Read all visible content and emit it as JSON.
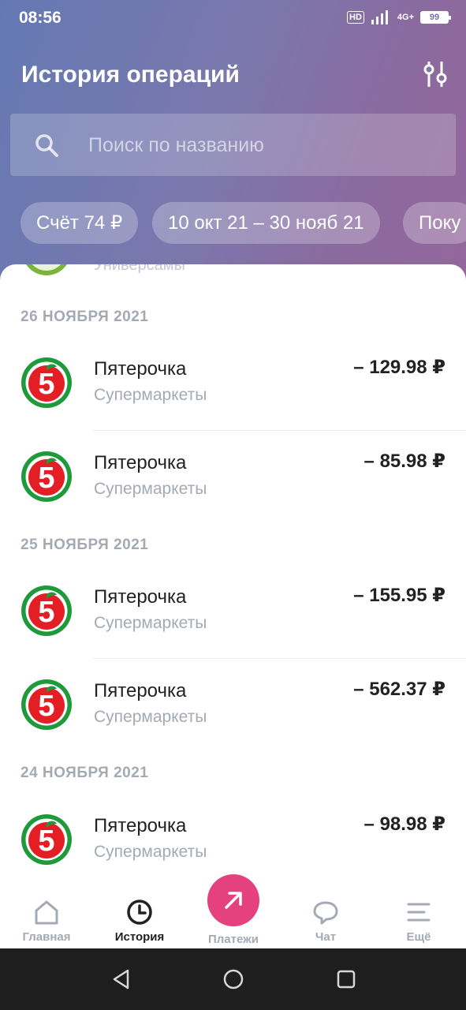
{
  "status": {
    "time": "08:56",
    "hd": "HD",
    "network": "4G+",
    "battery": "99"
  },
  "header": {
    "title": "История операций"
  },
  "search": {
    "placeholder": "Поиск по названию"
  },
  "chips": [
    "Счёт 74 ₽",
    "10 окт 21 – 30 нояб 21",
    "Поку"
  ],
  "partial_item": {
    "category": "Универсамы"
  },
  "groups": [
    {
      "date": "26 НОЯБРЯ 2021",
      "items": [
        {
          "name": "Пятерочка",
          "category": "Супермаркеты",
          "amount": "– 129.98 ₽"
        },
        {
          "name": "Пятерочка",
          "category": "Супермаркеты",
          "amount": "– 85.98 ₽"
        }
      ]
    },
    {
      "date": "25 НОЯБРЯ 2021",
      "items": [
        {
          "name": "Пятерочка",
          "category": "Супермаркеты",
          "amount": "– 155.95 ₽"
        },
        {
          "name": "Пятерочка",
          "category": "Супермаркеты",
          "amount": "– 562.37 ₽"
        }
      ]
    },
    {
      "date": "24 НОЯБРЯ 2021",
      "items": [
        {
          "name": "Пятерочка",
          "category": "Супермаркеты",
          "amount": "– 98.98 ₽"
        }
      ]
    }
  ],
  "nav": {
    "home": "Главная",
    "history": "История",
    "payments": "Платежи",
    "chat": "Чат",
    "more": "Ещё"
  },
  "colors": {
    "accent": "#e5417e",
    "logo_red": "#e31e24",
    "logo_green": "#1f9a3a",
    "muted": "#a4a9b3"
  }
}
